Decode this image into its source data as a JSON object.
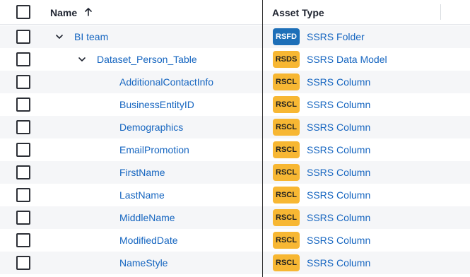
{
  "header": {
    "name_label": "Name",
    "asset_type_label": "Asset Type"
  },
  "rows": [
    {
      "name": "BI team",
      "badge": "RSFD",
      "type": "SSRS Folder"
    },
    {
      "name": "Dataset_Person_Table",
      "badge": "RSDS",
      "type": "SSRS Data Model"
    },
    {
      "name": "AdditionalContactInfo",
      "badge": "RSCL",
      "type": "SSRS Column"
    },
    {
      "name": "BusinessEntityID",
      "badge": "RSCL",
      "type": "SSRS Column"
    },
    {
      "name": "Demographics",
      "badge": "RSCL",
      "type": "SSRS Column"
    },
    {
      "name": "EmailPromotion",
      "badge": "RSCL",
      "type": "SSRS Column"
    },
    {
      "name": "FirstName",
      "badge": "RSCL",
      "type": "SSRS Column"
    },
    {
      "name": "LastName",
      "badge": "RSCL",
      "type": "SSRS Column"
    },
    {
      "name": "MiddleName",
      "badge": "RSCL",
      "type": "SSRS Column"
    },
    {
      "name": "ModifiedDate",
      "badge": "RSCL",
      "type": "SSRS Column"
    },
    {
      "name": "NameStyle",
      "badge": "RSCL",
      "type": "SSRS Column"
    }
  ],
  "icons": {
    "sort": "arrow-up-icon",
    "expand": "chevron-down-icon"
  },
  "colors": {
    "link": "#1565c0",
    "folder_badge": "#1d6fb8",
    "column_badge": "#f7b733"
  }
}
